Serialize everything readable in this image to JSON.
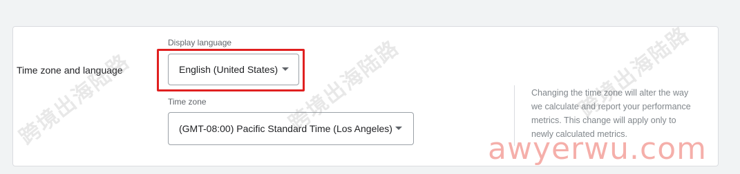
{
  "section": {
    "title": "Time zone and language"
  },
  "display_language": {
    "label": "Display language",
    "value": "English (United States)"
  },
  "time_zone": {
    "label": "Time zone",
    "value": "(GMT-08:00) Pacific Standard Time (Los Angeles)"
  },
  "help": {
    "text": "Changing the time zone will alter the way we calculate and report your performance metrics. This change will apply only to newly calculated metrics."
  },
  "watermark": {
    "text": "跨境出海陆路",
    "site": "awyerwu.com"
  },
  "colors": {
    "highlight": "#e02020",
    "site_mark": "#ec6e64"
  }
}
